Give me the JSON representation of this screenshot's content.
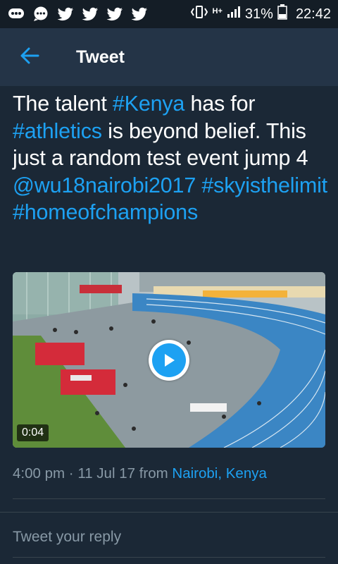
{
  "status_bar": {
    "battery_percent": "31%",
    "time": "22:42",
    "network_label": "H+",
    "icons": [
      "bbm-icon",
      "chat-bubble-icon",
      "twitter-icon",
      "twitter-icon",
      "twitter-icon",
      "twitter-icon",
      "vibrate-icon",
      "signal-icon",
      "battery-icon"
    ]
  },
  "header": {
    "title": "Tweet",
    "back_icon": "arrow-left-icon",
    "accent": "#1da1f2"
  },
  "tweet": {
    "text_parts": [
      {
        "t": "The talent ",
        "link": false
      },
      {
        "t": "#Kenya",
        "link": true
      },
      {
        "t": " has for ",
        "link": false
      },
      {
        "t": "#athletics",
        "link": true
      },
      {
        "t": " is beyond belief. This just a random test event jump 4 ",
        "link": false
      },
      {
        "t": "@wu18nairobi2017",
        "link": true
      },
      {
        "t": " ",
        "link": false
      },
      {
        "t": "#skyisthelimit",
        "link": true
      },
      {
        "t": " ",
        "link": false
      },
      {
        "t": "#homeofchampions",
        "link": true
      }
    ],
    "media": {
      "duration": "0:04",
      "play_icon": "play-icon"
    },
    "meta": {
      "time": "4:00 pm",
      "separator": "·",
      "date": "11 Jul 17",
      "from_label": "from",
      "location": "Nairobi, Kenya"
    }
  },
  "reply": {
    "placeholder": "Tweet your reply"
  },
  "colors": {
    "background": "#1b2836",
    "header_bg": "#243447",
    "status_bg": "#141d26",
    "link": "#1da1f2",
    "muted": "#8899a6"
  }
}
